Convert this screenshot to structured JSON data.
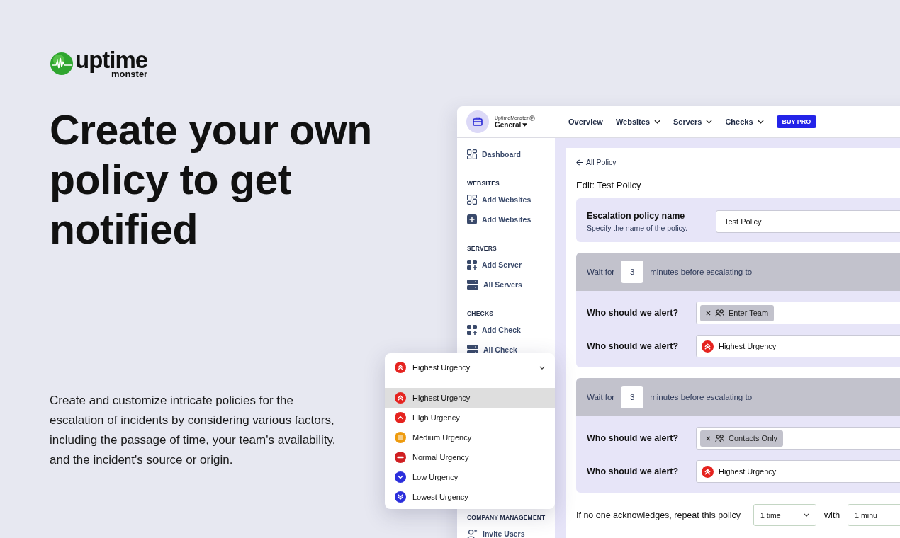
{
  "logo": {
    "word": "uptime",
    "sub": "monster"
  },
  "headline": "Create your own policy to get notified",
  "description": "Create and customize intricate policies for the escalation of incidents by considering various factors, including the passage of time, your team's availability, and the incident's source or origin.",
  "app": {
    "workspace": {
      "brand": "UptimeMonster",
      "name": "General"
    },
    "nav": [
      {
        "label": "Overview",
        "dropdown": false
      },
      {
        "label": "Websites",
        "dropdown": true
      },
      {
        "label": "Servers",
        "dropdown": true
      },
      {
        "label": "Checks",
        "dropdown": true
      }
    ],
    "buy_button": "BUY PRO",
    "sidebar_top": [
      {
        "kind": "grid",
        "label": "Dashboard"
      },
      {
        "kind": "section",
        "label": "WEBSITES"
      },
      {
        "kind": "grid",
        "label": "Add Websites"
      },
      {
        "kind": "plus",
        "label": "Add Websites"
      },
      {
        "kind": "section",
        "label": "SERVERS"
      },
      {
        "kind": "grid-add",
        "label": "Add Server"
      },
      {
        "kind": "servers",
        "label": "All Servers"
      },
      {
        "kind": "section",
        "label": "CHECKS"
      },
      {
        "kind": "grid-add",
        "label": "Add Check"
      },
      {
        "kind": "servers",
        "label": "All Check"
      }
    ],
    "sidebar_bottom": [
      {
        "kind": "section",
        "label": "COMPANY MANAGEMENT"
      },
      {
        "kind": "invite",
        "label": "Invite Users"
      }
    ],
    "back_link": "All Policy",
    "heading": "Edit: Test Policy",
    "name_field": {
      "label": "Escalation policy name",
      "hint": "Specify the name of the policy.",
      "value": "Test Policy"
    },
    "escalations": [
      {
        "wait_prefix": "Wait for",
        "wait": "3",
        "wait_suffix": "minutes before escalating to",
        "alerts": [
          {
            "kind": "tag",
            "label": "Who should we alert?",
            "value": "Enter Team"
          },
          {
            "kind": "urgency",
            "label": "Who should we alert?",
            "value": "Highest Urgency",
            "icon": {
              "kind": "highest",
              "color": "#e5231f"
            }
          }
        ]
      },
      {
        "wait_prefix": "Wait for",
        "wait": "3",
        "wait_suffix": "minutes before escalating to",
        "alerts": [
          {
            "kind": "tag",
            "label": "Who should we alert?",
            "value": "Contacts Only"
          },
          {
            "kind": "urgency",
            "label": "Who should we alert?",
            "value": "Highest Urgency",
            "icon": {
              "kind": "highest",
              "color": "#e5231f"
            }
          }
        ]
      }
    ],
    "repeat": {
      "label": "If no one acknowledges, repeat this policy",
      "times": "1 time",
      "with": "with",
      "interval": "1 minu"
    }
  },
  "urgency_dropdown": {
    "value": "Highest Urgency",
    "kind": "highest",
    "color": "#e5231f",
    "options": [
      {
        "label": "Highest Urgency",
        "kind": "highest",
        "color": "#e5231f",
        "selected": true
      },
      {
        "label": "High Urgency",
        "kind": "high",
        "color": "#e5231f",
        "selected": false
      },
      {
        "label": "Medium Urgency",
        "kind": "medium",
        "color": "#ee9b0e",
        "selected": false
      },
      {
        "label": "Normal Urgency",
        "kind": "normal",
        "color": "#d01f22",
        "selected": false
      },
      {
        "label": "Low Urgency",
        "kind": "low",
        "color": "#2c2fdc",
        "selected": false
      },
      {
        "label": "Lowest Urgency",
        "kind": "lowest",
        "color": "#2c2fdc",
        "selected": false
      }
    ]
  }
}
